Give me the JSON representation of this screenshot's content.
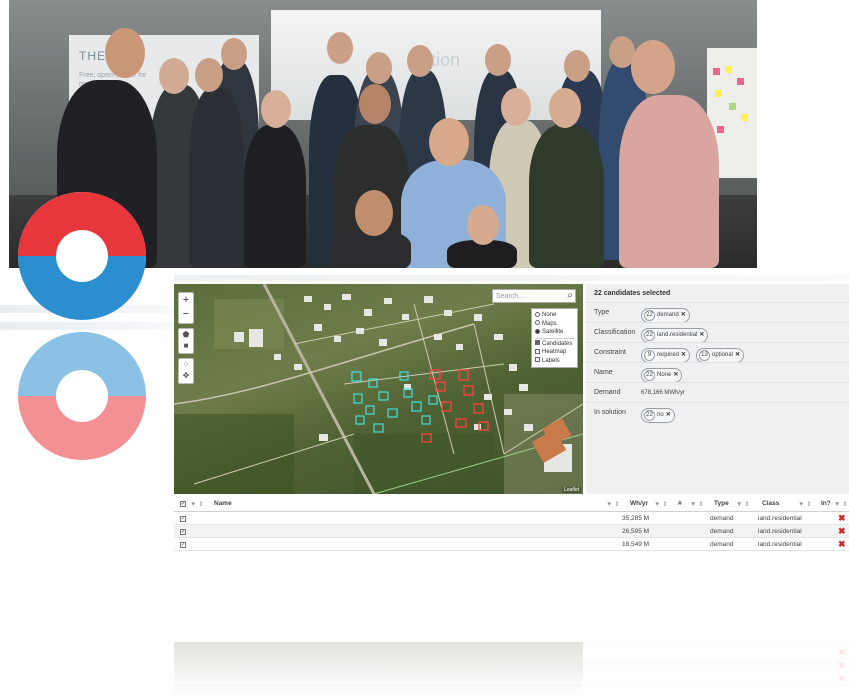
{
  "photo": {
    "banner_title": "THERM",
    "banner_sub": "Free, open-source for mo...",
    "screen_text": "ution"
  },
  "colors": {
    "logo_red": "#e8363d",
    "logo_blue": "#2b8fcf",
    "panel_bg": "#eef0f2",
    "remove_red": "#c62828"
  },
  "map": {
    "zoom_in": "+",
    "zoom_out": "−",
    "search_placeholder": "Search...",
    "layers": {
      "base": [
        {
          "label": "None",
          "selected": false
        },
        {
          "label": "Maps",
          "selected": false
        },
        {
          "label": "Satellite",
          "selected": true
        }
      ],
      "overlays": [
        {
          "label": "Candidates",
          "checked": true
        },
        {
          "label": "Heatmap",
          "checked": false
        },
        {
          "label": "Labels",
          "checked": false
        }
      ]
    },
    "attribution": "Leaflet"
  },
  "selection": {
    "header": "22 candidates selected",
    "type": {
      "label": "Type",
      "chips": [
        {
          "count": "22",
          "text": "demand"
        }
      ]
    },
    "classification": {
      "label": "Classification",
      "chips": [
        {
          "count": "22",
          "text": "land.residential"
        }
      ]
    },
    "constraint": {
      "label": "Constraint",
      "chips": [
        {
          "count": "9",
          "text": "required"
        },
        {
          "count": "13",
          "text": "optional"
        }
      ]
    },
    "name": {
      "label": "Name",
      "chips": [
        {
          "count": "22",
          "text": "None"
        }
      ]
    },
    "demand": {
      "label": "Demand",
      "value": "678,166 MWh/yr"
    },
    "in_solution": {
      "label": "In solution",
      "chips": [
        {
          "count": "22",
          "text": "no"
        }
      ]
    }
  },
  "table": {
    "headers": {
      "name": "Name",
      "whyr": "Wh/yr",
      "hash": "#",
      "type": "Type",
      "class": "Class",
      "in": "In?"
    },
    "filter_glyph": "▼ ⇕",
    "rows": [
      {
        "name": "",
        "whyr": "35,285 M",
        "type": "demand",
        "class": "land.residential"
      },
      {
        "name": "",
        "whyr": "26,595 M",
        "type": "demand",
        "class": "land.residential"
      },
      {
        "name": "",
        "whyr": "18,549 M",
        "type": "demand",
        "class": "land.residential"
      }
    ]
  }
}
